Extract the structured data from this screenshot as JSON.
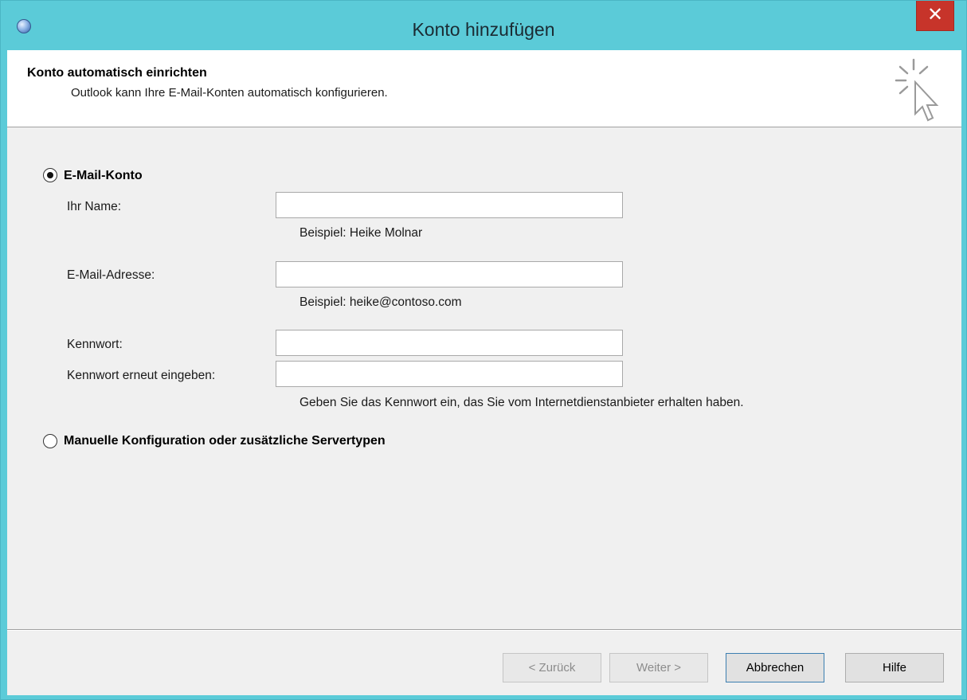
{
  "window": {
    "title": "Konto hinzufügen",
    "close_glyph": "✕",
    "app_icon": "outlook-globe-icon"
  },
  "header": {
    "title": "Konto automatisch einrichten",
    "subtitle": "Outlook kann Ihre E-Mail-Konten automatisch konfigurieren.",
    "icon": "sparkle-cursor-icon"
  },
  "options": {
    "email_account": {
      "label": "E-Mail-Konto",
      "selected": true
    },
    "manual_config": {
      "label": "Manuelle Konfiguration oder zusätzliche Servertypen",
      "selected": false
    }
  },
  "form": {
    "name": {
      "label": "Ihr Name:",
      "value": "",
      "hint": "Beispiel: Heike Molnar"
    },
    "email": {
      "label": "E-Mail-Adresse:",
      "value": "",
      "hint": "Beispiel: heike@contoso.com"
    },
    "password": {
      "label": "Kennwort:",
      "value": ""
    },
    "password_repeat": {
      "label": "Kennwort erneut eingeben:",
      "value": ""
    },
    "password_hint": "Geben Sie das Kennwort ein, das Sie vom Internetdienstanbieter erhalten haben."
  },
  "buttons": {
    "back": {
      "label": "< Zurück",
      "enabled": false
    },
    "next": {
      "label": "Weiter >",
      "enabled": false
    },
    "cancel": {
      "label": "Abbrechen",
      "enabled": true
    },
    "help": {
      "label": "Hilfe",
      "enabled": true
    }
  },
  "colors": {
    "titlebar": "#5bcbd8",
    "close_button": "#c7342a",
    "dialog_background": "#f0f0f0"
  }
}
